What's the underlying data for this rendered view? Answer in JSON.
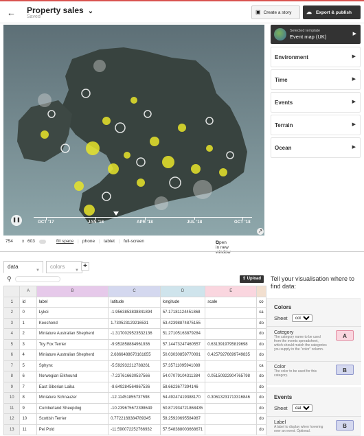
{
  "header": {
    "title": "Property sales",
    "status": "Saved",
    "story_label": "Create a story",
    "publish_label": "Export & publish"
  },
  "map": {
    "timeline": [
      "OCT '17",
      "JAN '18",
      "APR '18",
      "JUL '18",
      "OCT '18"
    ],
    "progress": 0.37
  },
  "sizebar": {
    "width": "754",
    "x": "x",
    "height": "603",
    "fill": "fill space",
    "phone": "phone",
    "tablet": "tablet",
    "full": "full-screen",
    "open": "Open in new window"
  },
  "sidebar": {
    "template_sub": "Selected template",
    "template_name": "Event map (UK)",
    "sections": [
      "Environment",
      "Time",
      "Events",
      "Terrain",
      "Ocean"
    ]
  },
  "sheets": {
    "tabs": [
      "data",
      "colors"
    ],
    "upload": "Upload"
  },
  "grid": {
    "columns": [
      "A",
      "B",
      "C",
      "D",
      "E"
    ],
    "rows": [
      [
        "1",
        "id",
        "label",
        "latitude",
        "longitude",
        "scale",
        "co"
      ],
      [
        "2",
        "0",
        "Lykoi",
        "-1.9563853838841894",
        "57.17181124451868",
        "",
        "ca"
      ],
      [
        "3",
        "1",
        "Keeshond",
        "1.730523129216531",
        "53.42398874875155",
        "",
        "do"
      ],
      [
        "4",
        "2",
        "Miniature Australian Shepherd",
        "-1.3170029523532136",
        "51.27105163879284",
        "",
        "do"
      ],
      [
        "5",
        "3",
        "Toy Fox Terrier",
        "-9.952858884961936",
        "57.14473247460557",
        "0.6313919795819698",
        "do"
      ],
      [
        "6",
        "4",
        "Miniature Australian Shepherd",
        "2.6866488670161655",
        "50.03030859770091",
        "0.42579276699749835",
        "do"
      ],
      [
        "7",
        "5",
        "Sphynx",
        "-5.592932212788261",
        "57.35711095941089",
        "",
        "ca"
      ],
      [
        "8",
        "6",
        "Norwegian Elkhound",
        "-7.237616630537566",
        "54.07079104311384",
        "0.05150922904765798",
        "do"
      ],
      [
        "9",
        "7",
        "East Siberian Laika",
        "-8.649284564867536",
        "58.6623677394146",
        "",
        "do"
      ],
      [
        "10",
        "8",
        "Miniature Schnauzer",
        "-12.11451855737598",
        "54.49247419388170",
        "0.30613231713316846",
        "do"
      ],
      [
        "11",
        "9",
        "Cumberland Sheepdog",
        "-10.239675672398649",
        "50.871934721868435",
        "",
        "do"
      ],
      [
        "12",
        "10",
        "Scottish Terrier",
        "0.7722168384789345",
        "58.25920695584987",
        "",
        "do"
      ],
      [
        "13",
        "11",
        "Pei Pold",
        "-11.590072252766932",
        "57.548388003668671",
        "",
        "do"
      ]
    ]
  },
  "panel": {
    "question": "Tell your visualisation where to find data:",
    "colors": {
      "title": "Colors",
      "sheet_label": "Sheet",
      "sheet_value": "colors",
      "category": {
        "name": "Category",
        "desc": "The category name to be used from the events spreadsheet, which should match the categories you supply in the \"color\" column.",
        "col": "A"
      },
      "color": {
        "name": "Color",
        "desc": "The color to be used for this category.",
        "col": "B"
      }
    },
    "events": {
      "title": "Events",
      "sheet_label": "Sheet",
      "sheet_value": "data",
      "label": {
        "name": "Label",
        "desc": "A label to display when hovering over an event. Optional.",
        "col": "B"
      }
    }
  }
}
